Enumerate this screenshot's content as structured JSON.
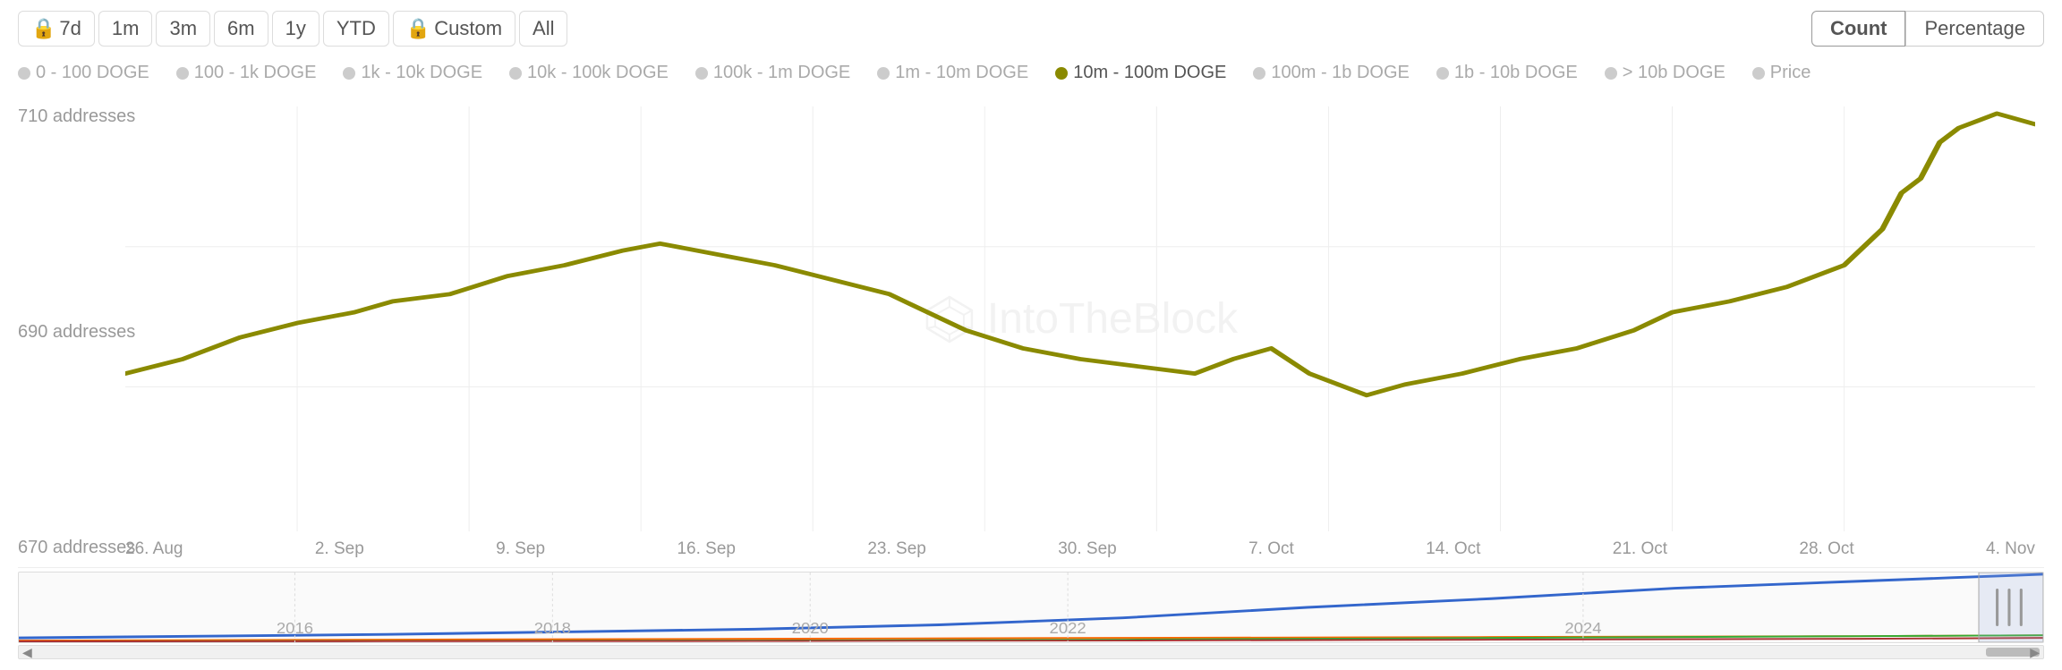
{
  "toolbar": {
    "time_buttons": [
      {
        "label": "🔒 7d",
        "id": "7d",
        "active": true
      },
      {
        "label": "1m",
        "id": "1m"
      },
      {
        "label": "3m",
        "id": "3m"
      },
      {
        "label": "6m",
        "id": "6m"
      },
      {
        "label": "1y",
        "id": "1y"
      },
      {
        "label": "YTD",
        "id": "ytd"
      },
      {
        "label": "🔒 Custom",
        "id": "custom"
      },
      {
        "label": "All",
        "id": "all"
      }
    ],
    "view_count_label": "Count",
    "view_percentage_label": "Percentage"
  },
  "legend": {
    "items": [
      {
        "label": "0 - 100 DOGE",
        "color": "#ccc",
        "active": false
      },
      {
        "label": "100 - 1k DOGE",
        "color": "#ccc",
        "active": false
      },
      {
        "label": "1k - 10k DOGE",
        "color": "#ccc",
        "active": false
      },
      {
        "label": "10k - 100k DOGE",
        "color": "#ccc",
        "active": false
      },
      {
        "label": "100k - 1m DOGE",
        "color": "#ccc",
        "active": false
      },
      {
        "label": "1m - 10m DOGE",
        "color": "#ccc",
        "active": false
      },
      {
        "label": "10m - 100m DOGE",
        "color": "#8a8a00",
        "active": true
      },
      {
        "label": "100m - 1b DOGE",
        "color": "#ccc",
        "active": false
      },
      {
        "label": "1b - 10b DOGE",
        "color": "#ccc",
        "active": false
      },
      {
        "label": "> 10b DOGE",
        "color": "#ccc",
        "active": false
      },
      {
        "label": "Price",
        "color": "#ccc",
        "active": false
      }
    ]
  },
  "chart": {
    "y_labels": [
      "710 addresses",
      "690 addresses",
      "670 addresses"
    ],
    "x_labels": [
      "26. Aug",
      "2. Sep",
      "9. Sep",
      "16. Sep",
      "23. Sep",
      "30. Sep",
      "7. Oct",
      "14. Oct",
      "21. Oct",
      "28. Oct",
      "4. Nov"
    ],
    "watermark": "IntoTheBlock",
    "line_color": "#8a8a00",
    "points": [
      {
        "x": 0.0,
        "y": 0.72
      },
      {
        "x": 0.03,
        "y": 0.68
      },
      {
        "x": 0.06,
        "y": 0.62
      },
      {
        "x": 0.09,
        "y": 0.58
      },
      {
        "x": 0.12,
        "y": 0.55
      },
      {
        "x": 0.14,
        "y": 0.52
      },
      {
        "x": 0.17,
        "y": 0.5
      },
      {
        "x": 0.2,
        "y": 0.45
      },
      {
        "x": 0.23,
        "y": 0.42
      },
      {
        "x": 0.26,
        "y": 0.38
      },
      {
        "x": 0.28,
        "y": 0.36
      },
      {
        "x": 0.31,
        "y": 0.39
      },
      {
        "x": 0.34,
        "y": 0.42
      },
      {
        "x": 0.37,
        "y": 0.46
      },
      {
        "x": 0.4,
        "y": 0.5
      },
      {
        "x": 0.42,
        "y": 0.55
      },
      {
        "x": 0.44,
        "y": 0.6
      },
      {
        "x": 0.47,
        "y": 0.65
      },
      {
        "x": 0.5,
        "y": 0.68
      },
      {
        "x": 0.53,
        "y": 0.7
      },
      {
        "x": 0.56,
        "y": 0.72
      },
      {
        "x": 0.58,
        "y": 0.68
      },
      {
        "x": 0.6,
        "y": 0.65
      },
      {
        "x": 0.62,
        "y": 0.72
      },
      {
        "x": 0.65,
        "y": 0.78
      },
      {
        "x": 0.67,
        "y": 0.75
      },
      {
        "x": 0.7,
        "y": 0.72
      },
      {
        "x": 0.73,
        "y": 0.68
      },
      {
        "x": 0.76,
        "y": 0.65
      },
      {
        "x": 0.79,
        "y": 0.6
      },
      {
        "x": 0.81,
        "y": 0.55
      },
      {
        "x": 0.84,
        "y": 0.52
      },
      {
        "x": 0.87,
        "y": 0.48
      },
      {
        "x": 0.9,
        "y": 0.42
      },
      {
        "x": 0.92,
        "y": 0.32
      },
      {
        "x": 0.93,
        "y": 0.22
      },
      {
        "x": 0.94,
        "y": 0.18
      },
      {
        "x": 0.95,
        "y": 0.08
      },
      {
        "x": 0.96,
        "y": 0.04
      },
      {
        "x": 0.97,
        "y": 0.02
      },
      {
        "x": 0.98,
        "y": 0.0
      },
      {
        "x": 1.0,
        "y": 0.03
      }
    ]
  },
  "mini_chart": {
    "year_labels": [
      "2016",
      "2018",
      "2020",
      "2022",
      "2024"
    ],
    "lines": [
      {
        "color": "#3366cc",
        "opacity": 0.9
      },
      {
        "color": "#ff6600",
        "opacity": 0.7
      },
      {
        "color": "#33aa33",
        "opacity": 0.7
      },
      {
        "color": "#aa3333",
        "opacity": 0.6
      }
    ]
  }
}
